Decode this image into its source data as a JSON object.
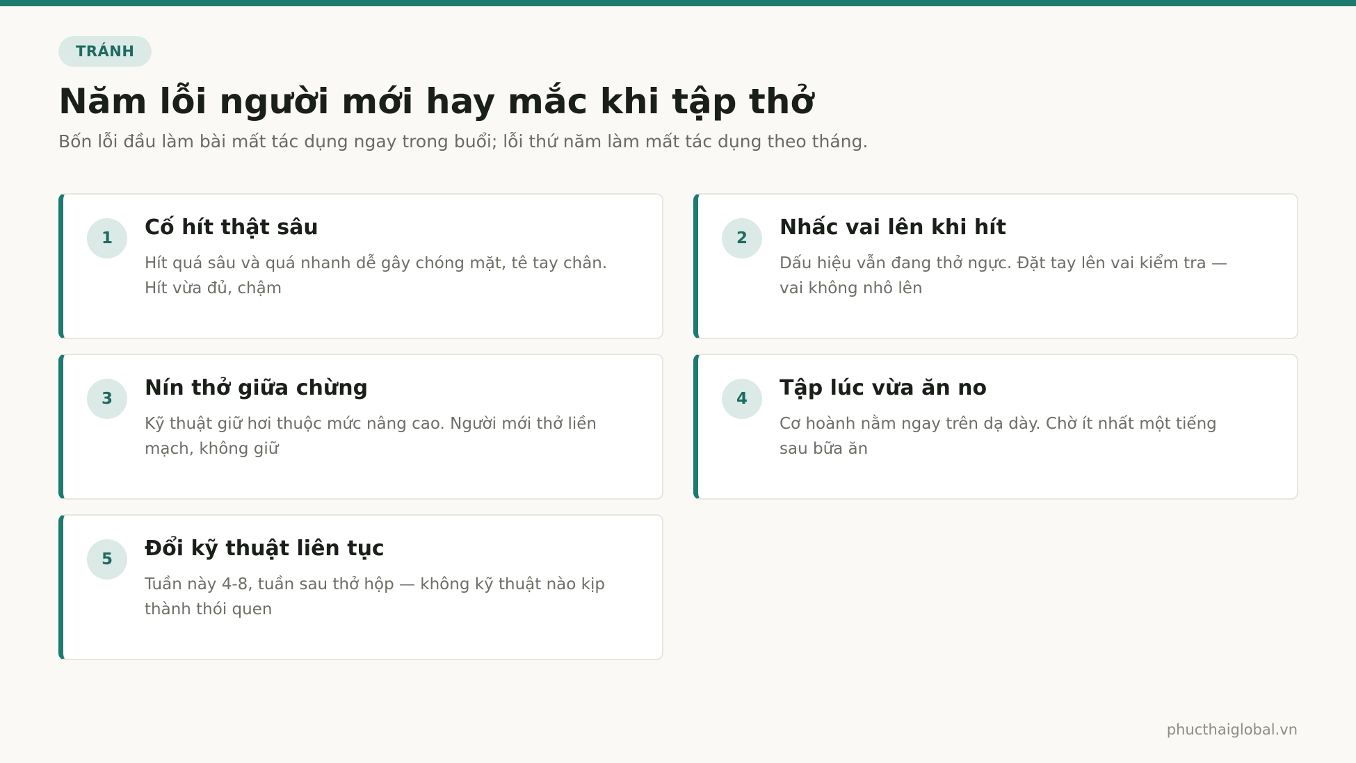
{
  "colors": {
    "accent": "#1d7a70",
    "tag_bg": "#dbeae6",
    "background": "#faf9f6",
    "card_bg": "#ffffff"
  },
  "header": {
    "tag": "TRÁNH",
    "title": "Năm lỗi người mới hay mắc khi tập thở",
    "subtitle": "Bốn lỗi đầu làm bài mất tác dụng ngay trong buổi; lỗi thứ năm làm mất tác dụng theo tháng."
  },
  "cards": [
    {
      "number": "1",
      "title": "Cố hít thật sâu",
      "description": "Hít quá sâu và quá nhanh dễ gây chóng mặt, tê tay chân. Hít vừa đủ, chậm"
    },
    {
      "number": "2",
      "title": "Nhấc vai lên khi hít",
      "description": "Dấu hiệu vẫn đang thở ngực. Đặt tay lên vai kiểm tra — vai không nhô lên"
    },
    {
      "number": "3",
      "title": "Nín thở giữa chừng",
      "description": "Kỹ thuật giữ hơi thuộc mức nâng cao. Người mới thở liền mạch, không giữ"
    },
    {
      "number": "4",
      "title": "Tập lúc vừa ăn no",
      "description": "Cơ hoành nằm ngay trên dạ dày. Chờ ít nhất một tiếng sau bữa ăn"
    },
    {
      "number": "5",
      "title": "Đổi kỹ thuật liên tục",
      "description": "Tuần này 4-8, tuần sau thở hộp — không kỹ thuật nào kịp thành thói quen"
    }
  ],
  "footer": {
    "website": "phucthaiglobal.vn"
  }
}
